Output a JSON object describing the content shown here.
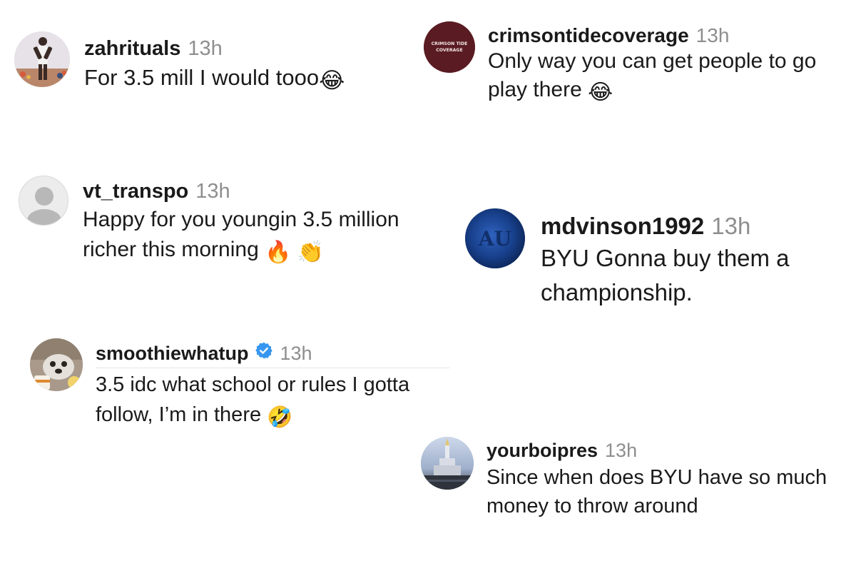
{
  "comments": [
    {
      "username": "zahrituals",
      "time": "13h",
      "text": "For 3.5 mill I would tooo",
      "emoji": "😂",
      "emoji_icon": "face-with-tears-of-joy-icon"
    },
    {
      "username": "crimsontidecoverage",
      "time": "13h",
      "text": "Only way you can get people to go play there",
      "emoji": "😂",
      "emoji_icon": "face-with-tears-of-joy-icon",
      "avatar_text": "CRIMSON TIDE COVERAGE"
    },
    {
      "username": "vt_transpo",
      "time": "13h",
      "text": "Happy for you youngin 3.5 million richer this morning",
      "emoji": "🔥",
      "emoji_icon": "fire-icon",
      "emoji2": "👏",
      "emoji2_icon": "clapping-hands-icon"
    },
    {
      "username": "mdvinson1992",
      "time": "13h",
      "text": "BYU Gonna buy them a championship.",
      "avatar_text": "AU"
    },
    {
      "username": "smoothiewhatup",
      "time": "13h",
      "verified": true,
      "text": "3.5 idc what school or rules I gotta follow, I’m in there",
      "emoji": "🤣",
      "emoji_icon": "rolling-on-floor-laughing-icon"
    },
    {
      "username": "yourboipres",
      "time": "13h",
      "text": "Since when does BYU have so much money to throw around"
    }
  ],
  "colors": {
    "username": "#1a1a1a",
    "timestamp": "#8e8e8e",
    "verified": "#3797f0",
    "crimson_avatar": "#5a1b22",
    "auburn_avatar": "#18408b"
  }
}
